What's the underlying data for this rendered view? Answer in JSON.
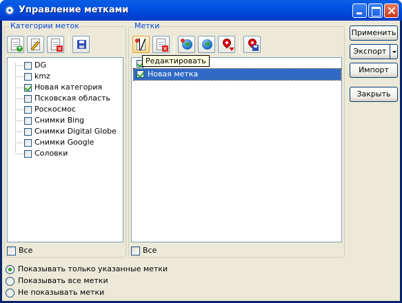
{
  "window": {
    "title": "Управление метками",
    "controls": [
      "minimize",
      "maximize",
      "close"
    ]
  },
  "categories_panel": {
    "title": "Категории меток",
    "toolbar": [
      "add-category-icon",
      "edit-category-icon",
      "delete-category-icon",
      "save-icon"
    ],
    "items": [
      {
        "label": "DG",
        "checked": false
      },
      {
        "label": "kmz",
        "checked": false
      },
      {
        "label": "Новая категория",
        "checked": true
      },
      {
        "label": "Псковская область",
        "checked": false
      },
      {
        "label": "Роскосмос",
        "checked": false
      },
      {
        "label": "Снимки Bing",
        "checked": false
      },
      {
        "label": "Снимки Digital Globe",
        "checked": false
      },
      {
        "label": "Снимки Google",
        "checked": false
      },
      {
        "label": "Соловки",
        "checked": false
      }
    ],
    "all_label": "Все",
    "all_checked": false
  },
  "marks_panel": {
    "title": "Метки",
    "toolbar": [
      "edit-mark-icon",
      "delete-mark-icon",
      "globe-icon",
      "globe-settings-icon",
      "map-pin-icon",
      "pin-save-icon"
    ],
    "tooltip": "Редактировать",
    "items": [
      {
        "label": "",
        "checked": true,
        "selected": false
      },
      {
        "label": "Новая метка",
        "checked": true,
        "selected": true
      }
    ],
    "all_label": "Все",
    "all_checked": false
  },
  "buttons": {
    "apply": "Применить",
    "export": "Экспорт",
    "import": "Импорт",
    "close": "Закрыть"
  },
  "display_options": [
    {
      "label": "Показывать только указанные метки",
      "checked": true
    },
    {
      "label": "Показывать все метки",
      "checked": false
    },
    {
      "label": "Не показывать метки",
      "checked": false
    }
  ],
  "colors": {
    "titlebar": "#0054e3",
    "dialog_bg": "#ece9d8",
    "selection": "#316ac5",
    "group_label": "#0046d5",
    "check_green": "#21a121"
  }
}
